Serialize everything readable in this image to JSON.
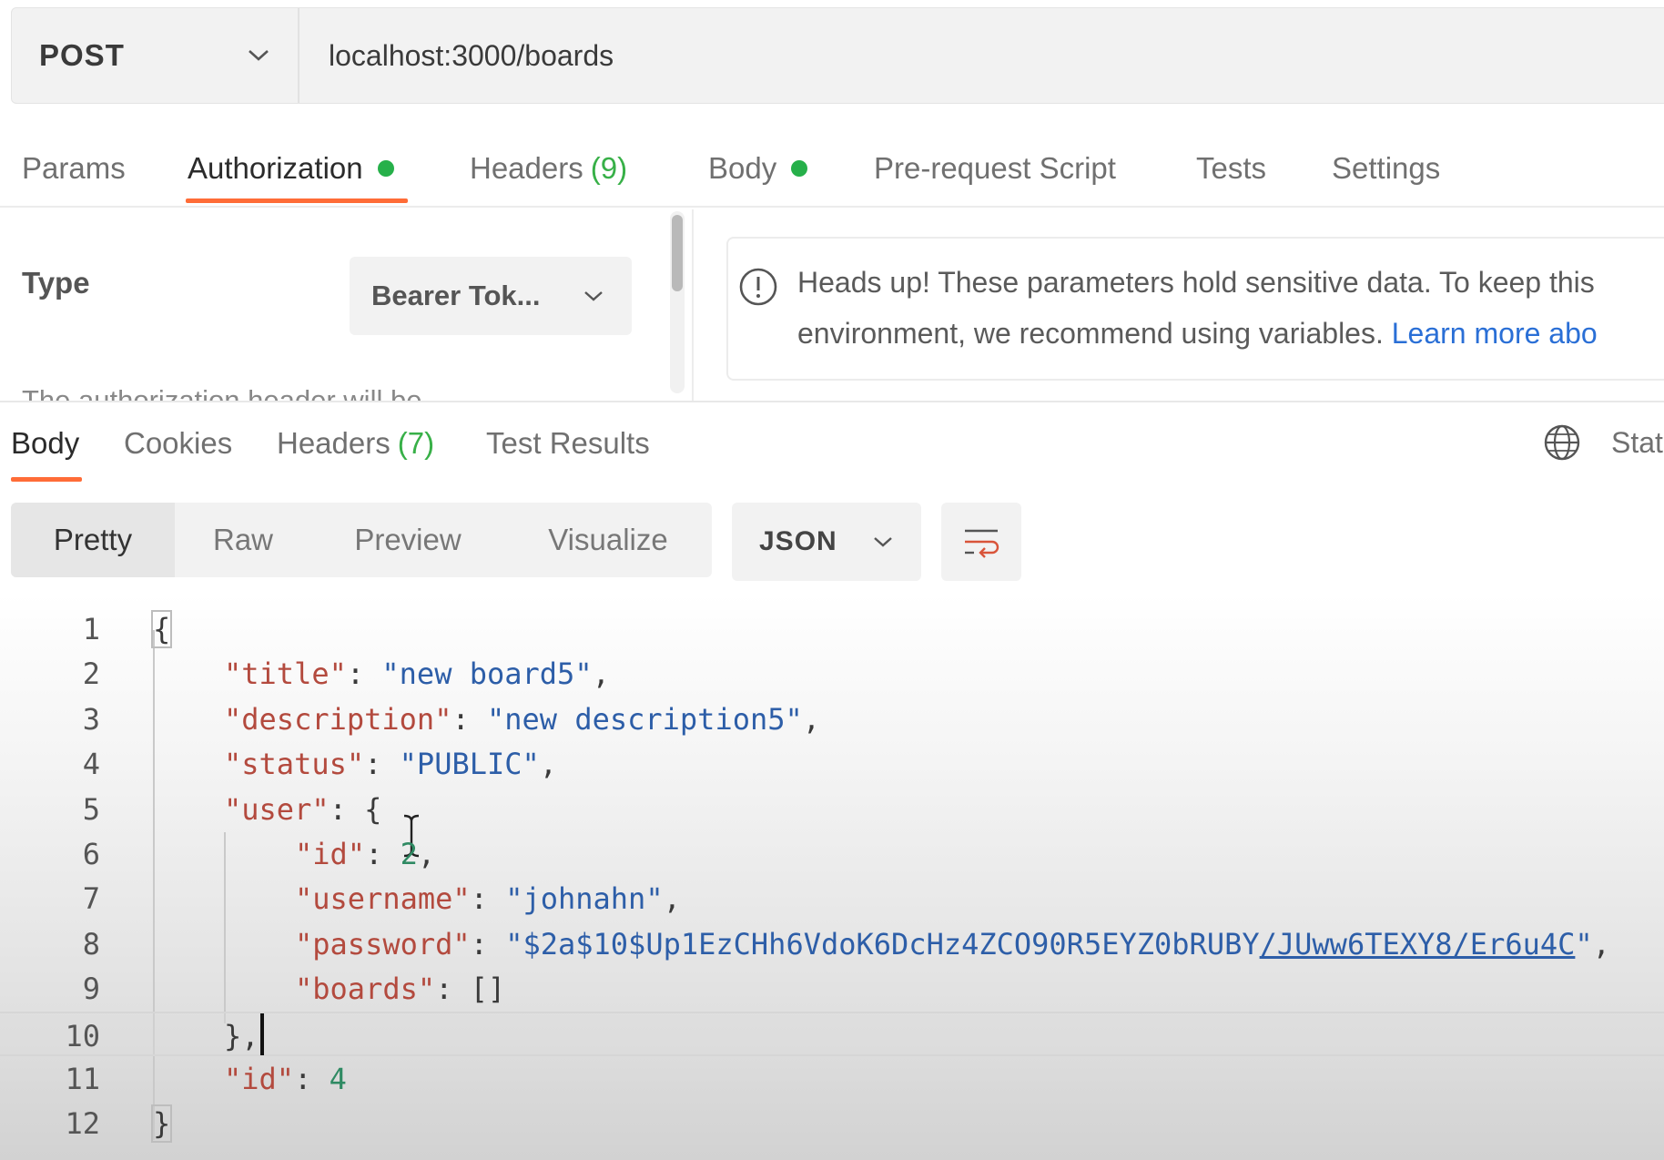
{
  "request": {
    "method": "POST",
    "url": "localhost:3000/boards"
  },
  "request_tabs": [
    {
      "label": "Params",
      "count": "",
      "dot": false,
      "active": false
    },
    {
      "label": "Authorization",
      "count": "",
      "dot": true,
      "active": true
    },
    {
      "label": "Headers",
      "count": "(9)",
      "dot": false,
      "active": false
    },
    {
      "label": "Body",
      "count": "",
      "dot": true,
      "active": false
    },
    {
      "label": "Pre-request Script",
      "count": "",
      "dot": false,
      "active": false
    },
    {
      "label": "Tests",
      "count": "",
      "dot": false,
      "active": false
    },
    {
      "label": "Settings",
      "count": "",
      "dot": false,
      "active": false
    }
  ],
  "auth": {
    "type_label": "Type",
    "type_value": "Bearer Tok...",
    "note_cutoff": "The authorization header will be"
  },
  "warning": {
    "line1": "Heads up! These parameters hold sensitive data. To keep this",
    "line2_text": "environment, we recommend using variables. ",
    "line2_link": "Learn more abo"
  },
  "response_tabs": [
    {
      "label": "Body",
      "count": "",
      "active": true
    },
    {
      "label": "Cookies",
      "count": "",
      "active": false
    },
    {
      "label": "Headers",
      "count": "(7)",
      "active": false
    },
    {
      "label": "Test Results",
      "count": "",
      "active": false
    }
  ],
  "status_label": "Stat",
  "view_modes": [
    {
      "label": "Pretty",
      "active": true
    },
    {
      "label": "Raw",
      "active": false
    },
    {
      "label": "Preview",
      "active": false
    },
    {
      "label": "Visualize",
      "active": false
    }
  ],
  "format": "JSON",
  "code_lines": [
    {
      "n": "1",
      "tokens": [
        [
          "p",
          "{"
        ]
      ]
    },
    {
      "n": "2",
      "tokens": [
        [
          "k",
          "\"title\""
        ],
        [
          "p",
          ": "
        ],
        [
          "s",
          "\"new board5\""
        ],
        [
          "p",
          ","
        ]
      ]
    },
    {
      "n": "3",
      "tokens": [
        [
          "k",
          "\"description\""
        ],
        [
          "p",
          ": "
        ],
        [
          "s",
          "\"new description5\""
        ],
        [
          "p",
          ","
        ]
      ]
    },
    {
      "n": "4",
      "tokens": [
        [
          "k",
          "\"status\""
        ],
        [
          "p",
          ": "
        ],
        [
          "s",
          "\"PUBLIC\""
        ],
        [
          "p",
          ","
        ]
      ]
    },
    {
      "n": "5",
      "tokens": [
        [
          "k",
          "\"user\""
        ],
        [
          "p",
          ": {"
        ]
      ]
    },
    {
      "n": "6",
      "tokens": [
        [
          "k",
          "\"id\""
        ],
        [
          "p",
          ": "
        ],
        [
          "n",
          "2"
        ],
        [
          "p",
          ","
        ]
      ]
    },
    {
      "n": "7",
      "tokens": [
        [
          "k",
          "\"username\""
        ],
        [
          "p",
          ": "
        ],
        [
          "s",
          "\"johnahn\""
        ],
        [
          "p",
          ","
        ]
      ]
    },
    {
      "n": "8",
      "tokens": [
        [
          "k",
          "\"password\""
        ],
        [
          "p",
          ": "
        ],
        [
          "s",
          "\"$2a$10$Up1EzCHh6VdoK6DcHz4ZCO90R5EYZ0bRUBY"
        ],
        [
          "su",
          "/JUww6TEXY8/Er6u4C"
        ],
        [
          "s",
          "\""
        ],
        [
          "p",
          ","
        ]
      ]
    },
    {
      "n": "9",
      "tokens": [
        [
          "k",
          "\"boards\""
        ],
        [
          "p",
          ": []"
        ]
      ]
    },
    {
      "n": "10",
      "tokens": [
        [
          "p",
          "},"
        ]
      ]
    },
    {
      "n": "11",
      "tokens": [
        [
          "k",
          "\"id\""
        ],
        [
          "p",
          ": "
        ],
        [
          "n",
          "4"
        ]
      ]
    },
    {
      "n": "12",
      "tokens": [
        [
          "p",
          "}"
        ]
      ]
    }
  ],
  "colors": {
    "accent": "#ff6c37",
    "dot_green": "#26b04a",
    "link_blue": "#2a6fd6",
    "json_key": "#b34a3e",
    "json_string": "#2d5ea8",
    "json_number": "#2f8a63"
  },
  "icons": {
    "method_dropdown": "chevron-down-icon",
    "warning": "exclamation-circle-icon",
    "globe": "globe-icon",
    "wrap": "wrap-lines-icon"
  }
}
